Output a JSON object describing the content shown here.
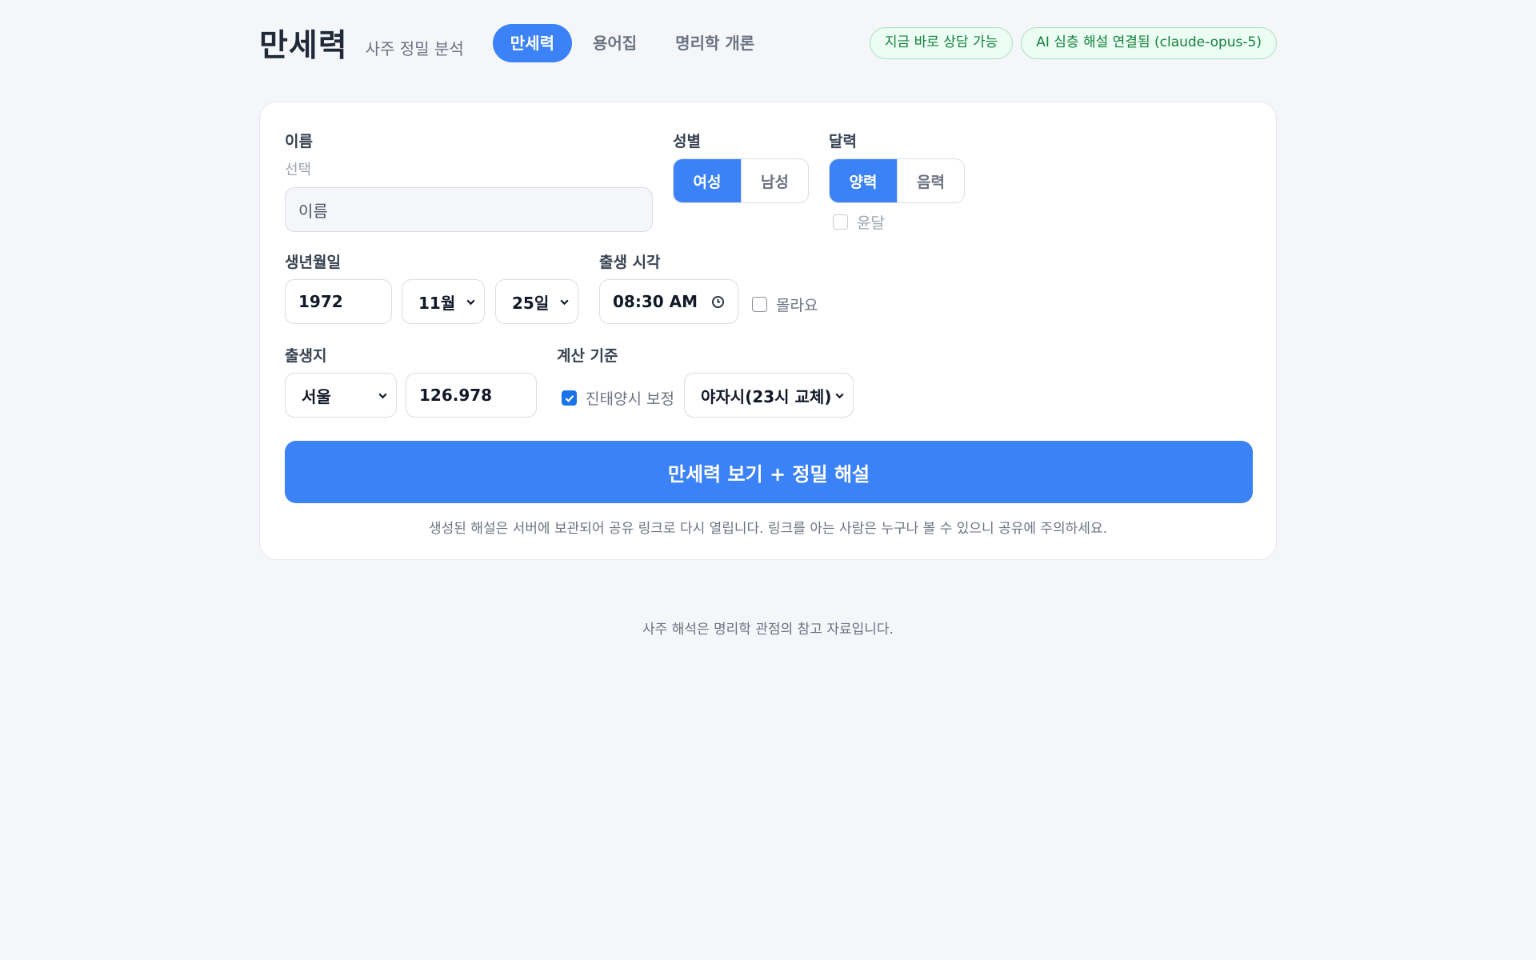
{
  "header": {
    "brand": "만세력",
    "subtitle": "사주 정밀 분석",
    "nav": [
      "만세력",
      "용어집",
      "명리학 개론"
    ],
    "badges": [
      "지금 바로 상담 가능",
      "AI 심층 해설 연결됨 (claude-opus-5)"
    ]
  },
  "form": {
    "name": {
      "label": "이름",
      "hint": "선택",
      "placeholder": "이름"
    },
    "gender": {
      "label": "성별",
      "options": [
        "여성",
        "남성"
      ],
      "selected": "여성"
    },
    "calendar": {
      "label": "달력",
      "options": [
        "양력",
        "음력"
      ],
      "selected": "양력",
      "leap_label": "윤달"
    },
    "birthdate": {
      "label": "생년월일",
      "year": "1972",
      "month": "11월",
      "day": "25일"
    },
    "birthtime": {
      "label": "출생 시각",
      "value": "08:30 AM",
      "unknown_label": "몰라요"
    },
    "birthplace": {
      "label": "출생지",
      "city": "서울",
      "longitude": "126.978"
    },
    "basis": {
      "label": "계산 기준",
      "solar_time_label": "진태양시 보정",
      "solar_time_checked": true,
      "night_mode": "야자시(23시 교체)"
    },
    "submit_label": "만세력 보기 + 정밀 해설",
    "note": "생성된 해설은 서버에 보관되어 공유 링크로 다시 열립니다. 링크를 아는 사람은 누구나 볼 수 있으니 공유에 주의하세요."
  },
  "footer": "사주 해석은 명리학 관점의 참고 자료입니다.",
  "colors": {
    "accent": "#3b82f6",
    "badge_text": "#15803d",
    "badge_bg": "#ecfdf3",
    "background": "#f4f6fa"
  },
  "icons": {
    "select": "chevron-down-icon",
    "time": "clock-icon",
    "check": "checkmark-icon"
  }
}
